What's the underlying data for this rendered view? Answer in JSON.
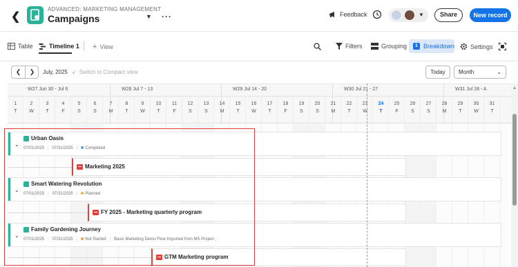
{
  "header": {
    "breadcrumb": "ADVANCED: MARKETING MANAGEMENT",
    "title": "Campaigns",
    "feedback_label": "Feedback",
    "share_label": "Share",
    "new_record_label": "New record",
    "icons": [
      "back-arrow-icon",
      "app-icon",
      "chevron-down-icon",
      "more-icon",
      "megaphone-icon",
      "history-icon",
      "avatar",
      "chevron-down-icon"
    ]
  },
  "toolbar": {
    "table_label": "Table",
    "timeline_label": "Timeline 1",
    "add_view_label": "View",
    "filters_label": "Filters",
    "grouping_label": "Grouping",
    "breakdown_label": "Breakdown",
    "breakdown_badge": "1",
    "settings_label": "Settings"
  },
  "timeline_controls": {
    "current_month": "July, 2025",
    "compact_label": "Switch to Compact view",
    "today_label": "Today",
    "scale_value": "Month"
  },
  "weeks": [
    {
      "label": "W27 Jun 30 - Jul 6"
    },
    {
      "label": "W28 Jul 7 - 13"
    },
    {
      "label": "W29 Jul 14 - 20"
    },
    {
      "label": "W30 Jul 21 - 27"
    },
    {
      "label": "W31 Jul 28 - A"
    }
  ],
  "days": [
    {
      "n": "1",
      "d": "T"
    },
    {
      "n": "2",
      "d": "W"
    },
    {
      "n": "3",
      "d": "T"
    },
    {
      "n": "4",
      "d": "F"
    },
    {
      "n": "5",
      "d": "S"
    },
    {
      "n": "6",
      "d": "S"
    },
    {
      "n": "7",
      "d": "M"
    },
    {
      "n": "8",
      "d": "T"
    },
    {
      "n": "9",
      "d": "W"
    },
    {
      "n": "10",
      "d": "T"
    },
    {
      "n": "11",
      "d": "F"
    },
    {
      "n": "12",
      "d": "S"
    },
    {
      "n": "13",
      "d": "S"
    },
    {
      "n": "14",
      "d": "M"
    },
    {
      "n": "15",
      "d": "T"
    },
    {
      "n": "16",
      "d": "W"
    },
    {
      "n": "17",
      "d": "T"
    },
    {
      "n": "18",
      "d": "F"
    },
    {
      "n": "19",
      "d": "S"
    },
    {
      "n": "20",
      "d": "S"
    },
    {
      "n": "21",
      "d": "M"
    },
    {
      "n": "22",
      "d": "T"
    },
    {
      "n": "23",
      "d": "W"
    },
    {
      "n": "24",
      "d": "T"
    },
    {
      "n": "25",
      "d": "F"
    },
    {
      "n": "26",
      "d": "S"
    },
    {
      "n": "27",
      "d": "S"
    },
    {
      "n": "28",
      "d": "M"
    },
    {
      "n": "29",
      "d": "T"
    },
    {
      "n": "30",
      "d": "W"
    },
    {
      "n": "31",
      "d": "T"
    }
  ],
  "today_day": "24",
  "projects": [
    {
      "name": "Urban Oasis",
      "start": "07/01/2025",
      "end": "07/31/2025",
      "status": "Completed",
      "status_color": "#5aa0e8",
      "extra": "",
      "program": "Marketing 2025"
    },
    {
      "name": "Smart Watering Revolution",
      "start": "07/01/2025",
      "end": "07/31/2025",
      "status": "Planned",
      "status_color": "#f2b23a",
      "extra": "",
      "program": "FY 2025 - Marketing quarterly program"
    },
    {
      "name": "Family Gardening Journey",
      "start": "07/01/2025",
      "end": "07/31/2025",
      "status": "Not Started",
      "status_color": "#f2a03a",
      "extra": "Basic Marketing Demo Flow Imported from MS Project ,",
      "program": "GTM Marketing program"
    }
  ],
  "colors": {
    "accent": "#1473e6",
    "project": "#2bb39a",
    "program": "#e3403c",
    "selection": "#e03c3c"
  }
}
